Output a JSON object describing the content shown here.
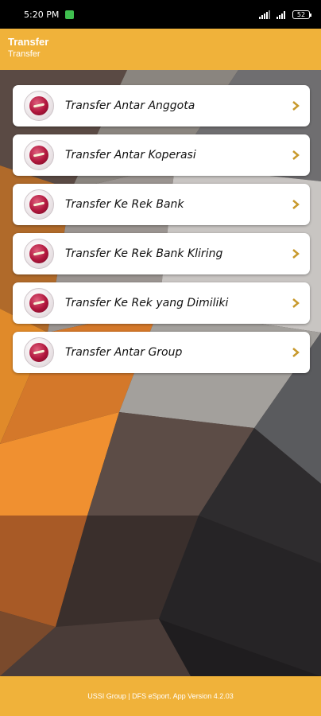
{
  "status": {
    "time": "5:20 PM",
    "signal": "4G",
    "battery": "52"
  },
  "header": {
    "title": "Transfer",
    "subtitle": "Transfer"
  },
  "menu": {
    "items": [
      {
        "label": "Transfer Antar Anggota"
      },
      {
        "label": "Transfer Antar Koperasi"
      },
      {
        "label": "Transfer Ke Rek Bank"
      },
      {
        "label": "Transfer Ke Rek Bank Kliring"
      },
      {
        "label": "Transfer Ke Rek yang Dimiliki"
      },
      {
        "label": "Transfer Antar Group"
      }
    ],
    "icon": "money-icon",
    "chevron_icon": "chevron-right-icon"
  },
  "footer": {
    "text": "USSI Group | DFS eSport. App Version 4.2.03"
  },
  "colors": {
    "accent": "#f0b23a",
    "chevron": "#c8992c",
    "icon_red": "#b0163c"
  }
}
